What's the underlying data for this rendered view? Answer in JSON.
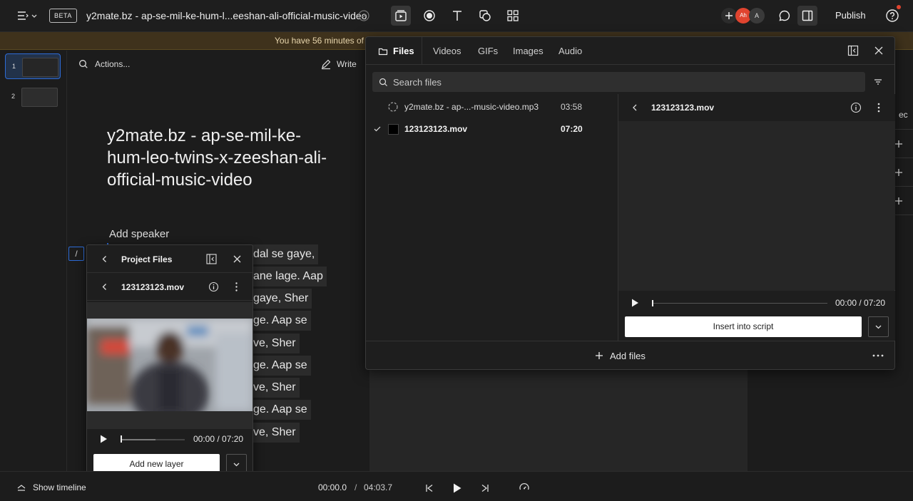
{
  "topbar": {
    "beta": "BETA",
    "title": "y2mate.bz - ap-se-mil-ke-hum-l...eeshan-ali-official-music-video",
    "avatar_initials": "Ah",
    "avatar2_initial": "A",
    "publish": "Publish"
  },
  "banner": {
    "text": "You have 56 minutes of"
  },
  "rail": {
    "scenes": [
      "1",
      "2"
    ]
  },
  "editor": {
    "actions": "Actions...",
    "write": "Write",
    "script_title": "y2mate.bz - ap-se-mil-ke-hum-leo-twins-x-zeeshan-ali-official-music-video",
    "add_speaker": "Add speaker",
    "slash": "/",
    "lines": [
      "dal se gaye,",
      "ane lage. Aap",
      "gaye, Sher",
      "ge. Aap se",
      "ve, Sher",
      "ge. Aap se",
      "ve, Sher",
      "ge. Aap se",
      "ve, Sher"
    ]
  },
  "props_panel": {
    "partial_label": "ec"
  },
  "files_panel": {
    "tabs": [
      "Files",
      "Videos",
      "GIFs",
      "Images",
      "Audio"
    ],
    "search_placeholder": "Search files",
    "files": [
      {
        "name": "y2mate.bz - ap-...-music-video.mp3",
        "duration": "03:58",
        "selected": false
      },
      {
        "name": "123123123.mov",
        "duration": "07:20",
        "selected": true
      }
    ],
    "preview": {
      "name": "123123123.mov",
      "time": "00:00 / 07:20",
      "insert_label": "Insert into script"
    },
    "add_files": "Add files"
  },
  "project_files": {
    "title": "Project Files",
    "file_name": "123123123.mov",
    "time": "00:00 / 07:20",
    "add_layer_label": "Add new layer"
  },
  "bottombar": {
    "show_timeline": "Show timeline",
    "current_time": "00:00.0",
    "separator": "/",
    "total_time": "04:03.7"
  },
  "colors": {
    "accent_red": "#e0442f",
    "banner_bg": "#3f321c",
    "focus_blue": "#2d6bd6"
  }
}
